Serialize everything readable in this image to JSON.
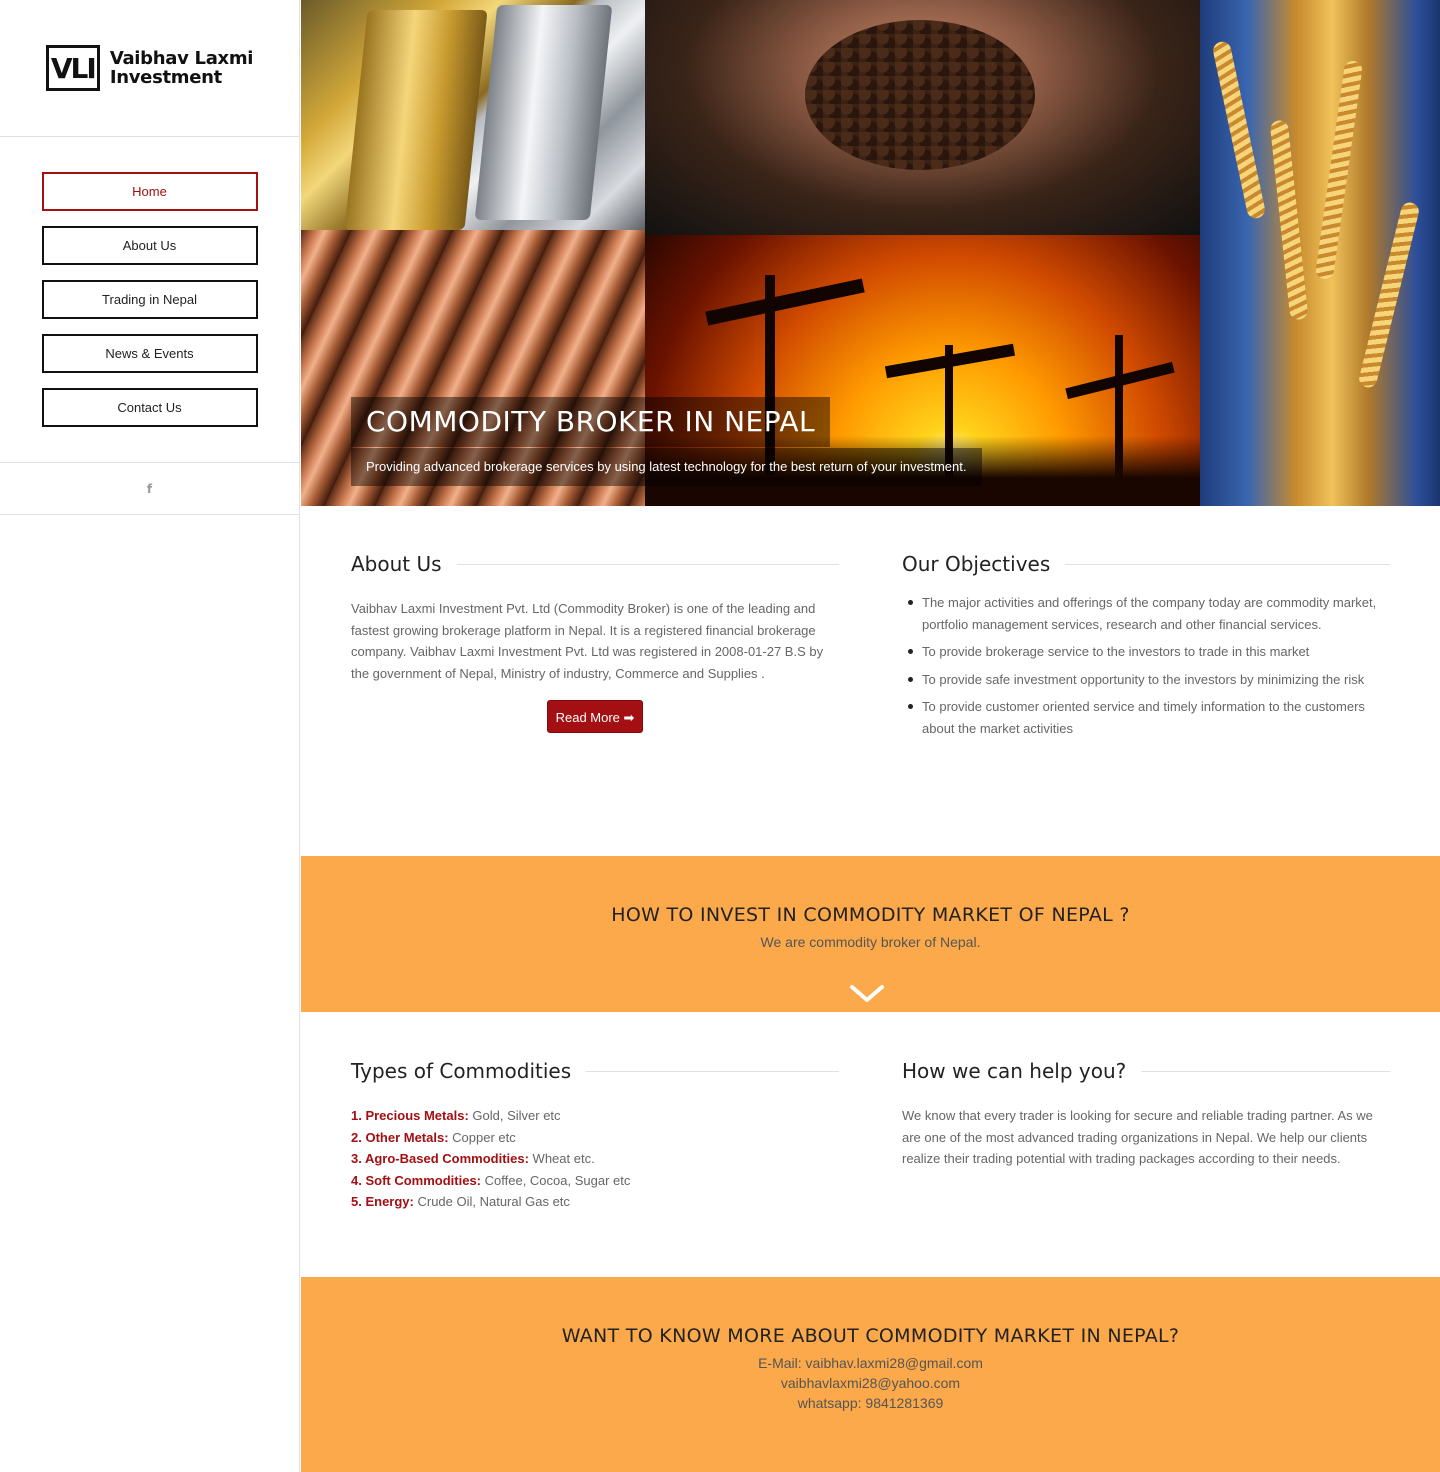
{
  "brand": {
    "mark": "VLI",
    "name_line1": "Vaibhav Laxmi",
    "name_line2": "Investment"
  },
  "nav": {
    "items": [
      {
        "label": "Home",
        "active": true
      },
      {
        "label": "About Us",
        "active": false
      },
      {
        "label": "Trading in Nepal",
        "active": false
      },
      {
        "label": "News & Events",
        "active": false
      },
      {
        "label": "Contact Us",
        "active": false
      }
    ]
  },
  "social": {
    "facebook_icon": "f"
  },
  "hero": {
    "title": "COMMODITY BROKER IN NEPAL",
    "subtitle": "Providing advanced brokerage services by using latest technology for the best return of your investment."
  },
  "about": {
    "heading": "About Us",
    "text": "Vaibhav Laxmi Investment Pvt. Ltd (Commodity Broker) is one of the leading and fastest growing brokerage platform in Nepal. It is a registered financial brokerage company. Vaibhav Laxmi Investment Pvt. Ltd was registered in 2008-01-27 B.S by the government of Nepal, Ministry of industry, Commerce and Supplies .",
    "button": "Read More ➡"
  },
  "objectives": {
    "heading": "Our Objectives",
    "items": [
      "The major activities and offerings of the company today are commodity market, portfolio management services, research and other financial services.",
      "To provide brokerage service to the investors to trade in this market",
      "To provide safe investment opportunity to the investors by minimizing the risk",
      "To provide customer oriented service and timely information to the customers about the market activities"
    ]
  },
  "invest_band": {
    "title": "HOW TO INVEST IN COMMODITY MARKET OF NEPAL ?",
    "subtitle": "We are commodity broker of Nepal."
  },
  "commodities": {
    "heading": "Types of Commodities",
    "items": [
      {
        "key": "1. Precious Metals:",
        "value": " Gold, Silver etc"
      },
      {
        "key": "2. Other Metals:",
        "value": "  Copper etc"
      },
      {
        "key": "3. Agro-Based Commodities:",
        "value": " Wheat etc."
      },
      {
        "key": "4. Soft Commodities:",
        "value": " Coffee, Cocoa, Sugar etc"
      },
      {
        "key": "5. Energy:",
        "value": " Crude Oil, Natural Gas  etc"
      }
    ]
  },
  "help": {
    "heading": "How we can help you?",
    "text": "We know that every trader is looking for secure and reliable trading partner. As we are one of the most advanced trading organizations in Nepal. We help our clients realize their trading potential with trading packages according to their needs."
  },
  "contact_band": {
    "title": "WANT TO KNOW MORE ABOUT COMMODITY MARKET IN NEPAL?",
    "email_line": "E-Mail: vaibhav.laxmi28@gmail.com",
    "email2": "vaibhavlaxmi28@yahoo.com",
    "whatsapp": "whatsapp: 9841281369"
  },
  "colors": {
    "accent": "#a30f12",
    "band": "#fba94a"
  }
}
